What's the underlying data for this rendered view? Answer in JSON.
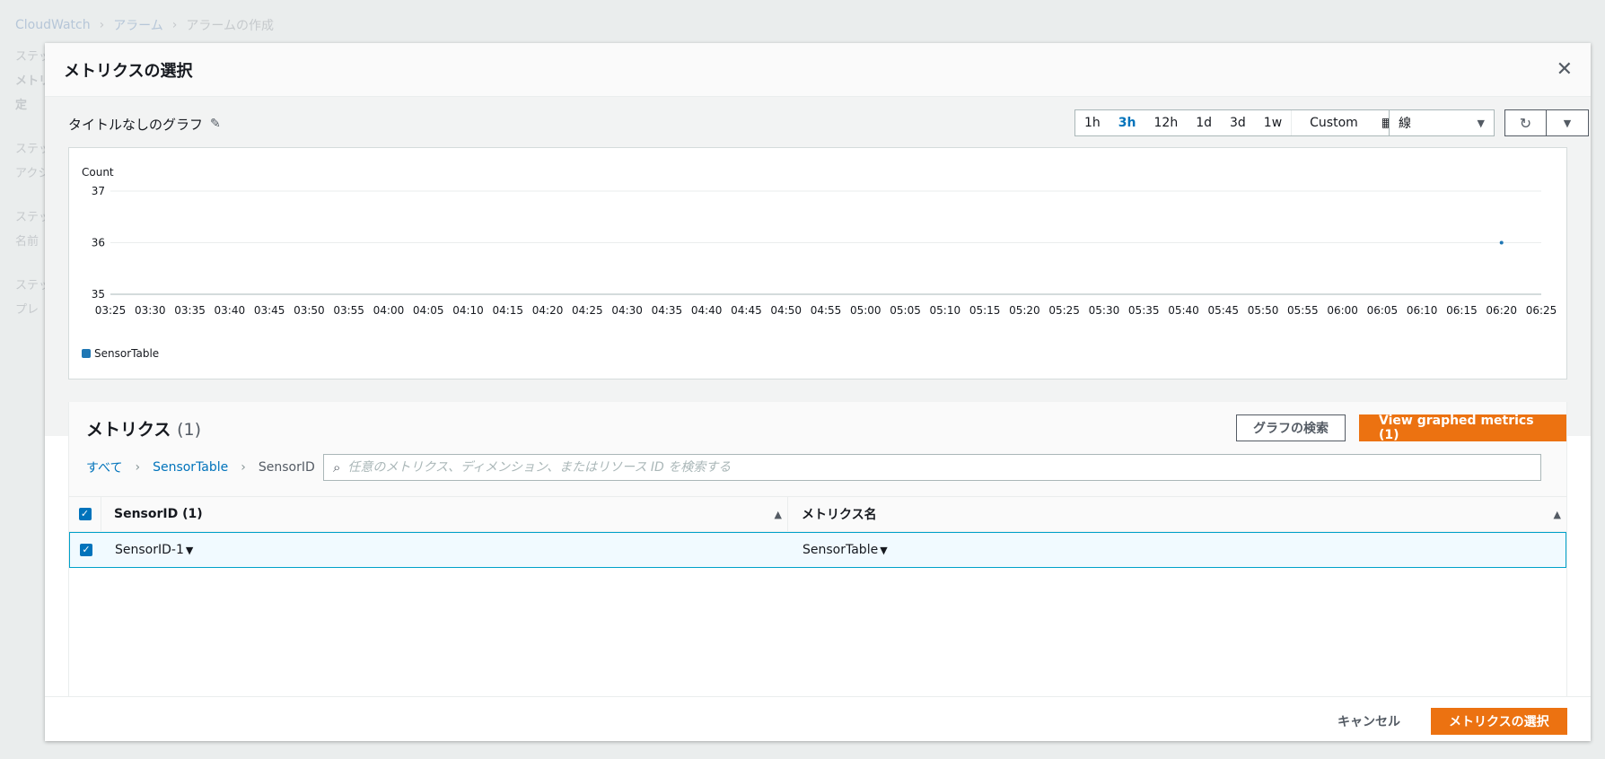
{
  "background": {
    "breadcrumb": [
      "CloudWatch",
      "アラーム",
      "アラームの作成"
    ],
    "steps": [
      "ステップ",
      "メトリ",
      "定",
      "ステップ",
      "アクシ",
      "ステップ",
      "名前",
      "ステップ",
      "プレ"
    ]
  },
  "modal": {
    "title": "メトリクスの選択",
    "graph_title": "タイトルなしのグラフ",
    "time_ranges": [
      "1h",
      "3h",
      "12h",
      "1d",
      "3d",
      "1w"
    ],
    "active_range": "3h",
    "custom_label": "Custom",
    "graph_type": "線",
    "legend_label": "SensorTable",
    "metrics_title": "メトリクス",
    "metrics_count": "(1)",
    "graph_search_button": "グラフの検索",
    "view_graphed_button": "View graphed metrics (1)",
    "breadcrumb": {
      "all": "すべて",
      "namespace": "SensorTable",
      "dimension": "SensorID"
    },
    "search_placeholder": "任意のメトリクス、ディメンション、またはリソース ID を検索する",
    "table": {
      "col1_header": "SensorID (1)",
      "col2_header": "メトリクス名",
      "rows": [
        {
          "sensor_id": "SensorID-1",
          "metric_name": "SensorTable"
        }
      ]
    },
    "cancel_button": "キャンセル",
    "select_button": "メトリクスの選択"
  },
  "colors": {
    "accent": "#ec7211",
    "link": "#0073bb",
    "series": "#1f77b4"
  },
  "chart_data": {
    "type": "line",
    "ylabel": "Count",
    "ylim": [
      35,
      37
    ],
    "yticks": [
      "37",
      "36",
      "35"
    ],
    "xticks": [
      "03:25",
      "03:30",
      "03:35",
      "03:40",
      "03:45",
      "03:50",
      "03:55",
      "04:00",
      "04:05",
      "04:10",
      "04:15",
      "04:20",
      "04:25",
      "04:30",
      "04:35",
      "04:40",
      "04:45",
      "04:50",
      "04:55",
      "05:00",
      "05:05",
      "05:10",
      "05:15",
      "05:20",
      "05:25",
      "05:30",
      "05:35",
      "05:40",
      "05:45",
      "05:50",
      "05:55",
      "06:00",
      "06:05",
      "06:10",
      "06:15",
      "06:20",
      "06:25"
    ],
    "series": [
      {
        "name": "SensorTable",
        "points": [
          {
            "x": "06:20",
            "y": 36
          }
        ]
      }
    ],
    "grid": true,
    "legend": "bottom-left"
  }
}
